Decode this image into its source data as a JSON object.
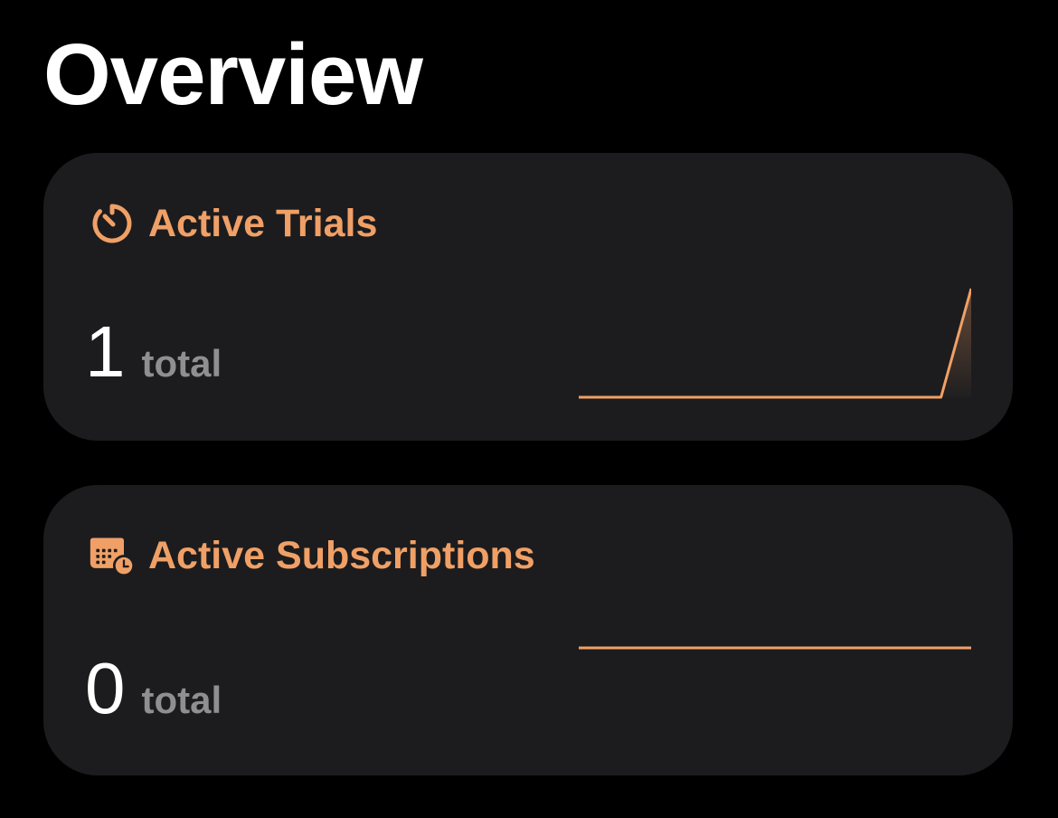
{
  "page": {
    "title": "Overview"
  },
  "theme": {
    "background": "#000000",
    "card_background": "#1c1c1e",
    "accent": "#f0a066",
    "unit_color": "#8e8e93"
  },
  "cards": [
    {
      "id": "active-trials",
      "icon": "timer-icon",
      "title": "Active Trials",
      "value": "1",
      "unit": "total",
      "chart_data": {
        "type": "area",
        "values": [
          0,
          0,
          0,
          0,
          0,
          0,
          0,
          0,
          0,
          0,
          0,
          0,
          0,
          1
        ],
        "ylim": [
          0,
          1
        ]
      }
    },
    {
      "id": "active-subscriptions",
      "icon": "calendar-clock-icon",
      "title": "Active Subscriptions",
      "value": "0",
      "unit": "total",
      "chart_data": {
        "type": "line",
        "values": [
          0,
          0,
          0,
          0,
          0,
          0,
          0,
          0,
          0,
          0,
          0,
          0,
          0,
          0
        ],
        "ylim": [
          0,
          1
        ]
      }
    }
  ]
}
